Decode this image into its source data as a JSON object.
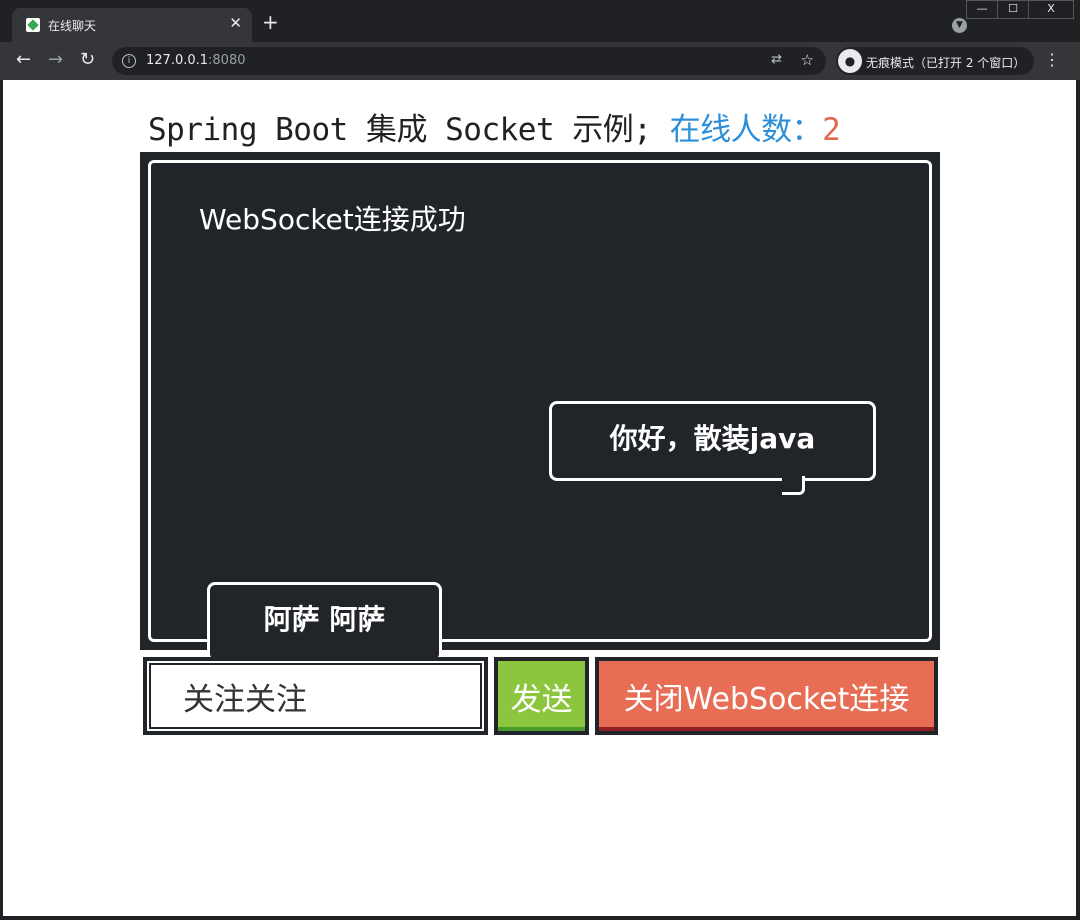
{
  "browser": {
    "tab_title": "在线聊天",
    "tab_close": "✕",
    "new_tab": "+",
    "url_host": "127.0.0.1",
    "url_port": ":8080",
    "incognito_label": "无痕模式（已打开 2 个窗口）",
    "window_controls": {
      "minimize": "—",
      "maximize": "☐",
      "close": "X"
    }
  },
  "page": {
    "heading_text": "Spring Boot 集成 Socket 示例;",
    "online_label": "在线人数：",
    "online_count": "2"
  },
  "chat": {
    "system_message": "WebSocket连接成功",
    "messages": [
      {
        "side": "right",
        "text": "你好，散装java"
      },
      {
        "side": "left",
        "text": "阿萨 阿萨"
      }
    ]
  },
  "composer": {
    "input_value": "关注关注",
    "send_label": "发送",
    "close_label": "关闭WebSocket连接"
  },
  "colors": {
    "online_label": "#2e8fd8",
    "online_count": "#e0694e",
    "send_button": "#8cc63f",
    "close_button": "#e76e55",
    "chat_background": "#212529"
  }
}
